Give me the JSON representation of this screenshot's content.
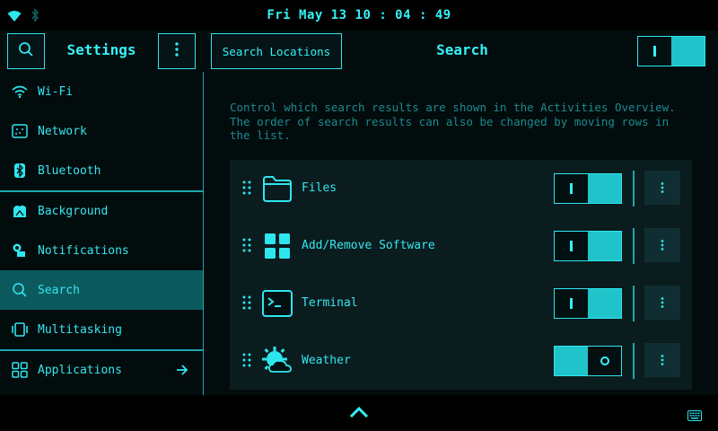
{
  "topbar": {
    "clock": "Fri May 13 10 : 04 : 49",
    "icons": [
      "wifi-icon",
      "bluetooth-icon"
    ]
  },
  "header": {
    "settings_title": "Settings",
    "search_locations_label": "Search Locations",
    "page_title": "Search",
    "master_toggle": "on"
  },
  "sidebar": {
    "items": [
      {
        "label": "Wi-Fi",
        "icon": "wifi-icon"
      },
      {
        "label": "Network",
        "icon": "network-icon"
      },
      {
        "label": "Bluetooth",
        "icon": "bluetooth-icon"
      },
      {
        "label": "Background",
        "icon": "background-icon"
      },
      {
        "label": "Notifications",
        "icon": "notifications-icon"
      },
      {
        "label": "Search",
        "icon": "search-icon",
        "active": true
      },
      {
        "label": "Multitasking",
        "icon": "multitasking-icon"
      },
      {
        "label": "Applications",
        "icon": "applications-icon"
      }
    ]
  },
  "main": {
    "description": "Control which search results are shown in the Activities Overview. The order of search results can also be changed by moving rows in the list.",
    "rows": [
      {
        "name": "Files",
        "icon": "folder-icon",
        "enabled": true
      },
      {
        "name": "Add/Remove Software",
        "icon": "software-grid-icon",
        "enabled": true
      },
      {
        "name": "Terminal",
        "icon": "terminal-icon",
        "enabled": true
      },
      {
        "name": "Weather",
        "icon": "weather-icon",
        "enabled": false
      }
    ]
  },
  "colors": {
    "accent": "#2ee6ee",
    "accent_fill": "#1fc3c9",
    "active_bg": "#0c5a5e",
    "background": "#030c0d"
  }
}
